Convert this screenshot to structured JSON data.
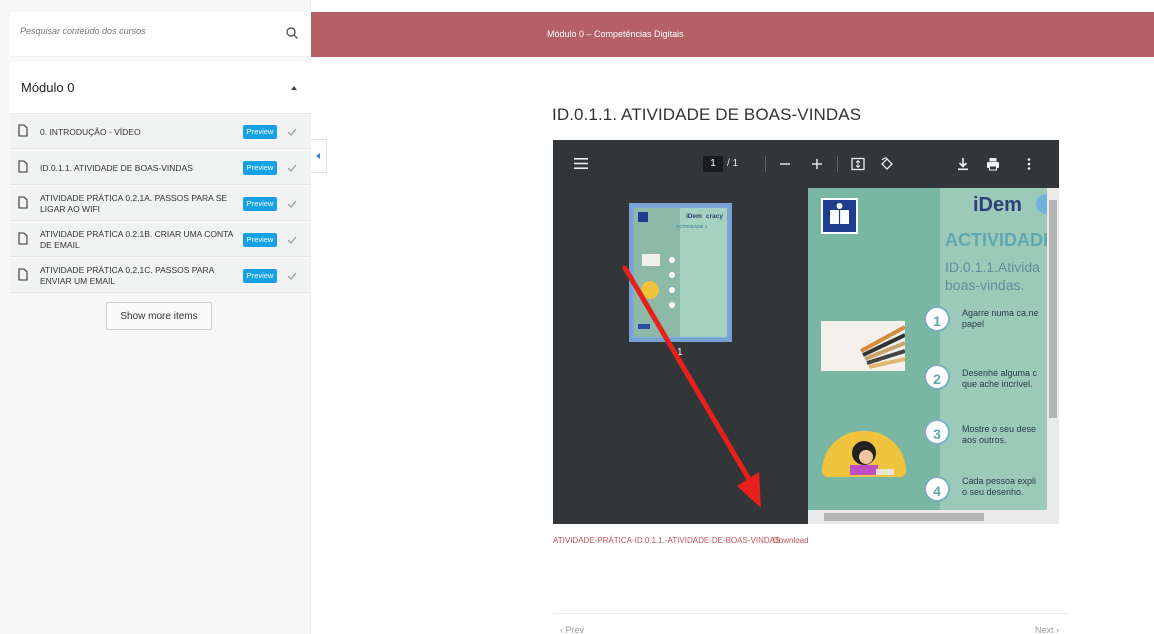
{
  "sidebar": {
    "search_placeholder": "Pesquisar conteúdo dos cursos",
    "section_title": "Módulo 0",
    "lessons": [
      {
        "title": "0. INTRODUÇÃO - VÍDEO",
        "badge": "Preview"
      },
      {
        "title": "ID.0.1.1. ATIVIDADE DE BOAS-VINDAS",
        "badge": "Preview"
      },
      {
        "title": "ATIVIDADE PRÁTICA 0.2.1A. PASSOS PARA SE LIGAR AO WIFI",
        "badge": "Preview"
      },
      {
        "title": "ATIVIDADE PRÁTICA 0.2.1B. CRIAR UMA CONTA DE EMAIL",
        "badge": "Preview"
      },
      {
        "title": "ATIVIDADE PRÁTICA 0.2.1C. PASSOS PARA ENVIAR UM EMAIL",
        "badge": "Preview"
      }
    ],
    "show_more_label": "Show more items"
  },
  "header": {
    "title": "Módulo 0 – Competências Digitais"
  },
  "main": {
    "page_title": "ID.0.1.1. ATIVIDADE DE BOAS-VINDAS",
    "pdf": {
      "current_page": "1",
      "page_total": "/ 1",
      "thumb_page_label": "1",
      "doc_brand": "iDem",
      "doc_heading": "ACTIVIDADE",
      "doc_subtitle_line1": "ID.0.1.1.Ativida",
      "doc_subtitle_line2": "boas-vindas.",
      "steps": [
        {
          "num": "1",
          "line1": "Agarre numa ca.ne",
          "line2": "papel"
        },
        {
          "num": "2",
          "line1": "Desenhe alguma c",
          "line2": "que ache incrível."
        },
        {
          "num": "3",
          "line1": "Mostre o seu dese",
          "line2": "aos outros."
        },
        {
          "num": "4",
          "line1": "Cada pessoa expli",
          "line2": "o seu desenho."
        }
      ]
    },
    "file_name": "ATIVIDADE-PRÁTICA-ID.0.1.1.-ATIVIDADE-DE-BOAS-VINDAS",
    "download_label": "Download",
    "prev_label": "‹ Prev",
    "next_label": "Next ›"
  },
  "colors": {
    "header_bg": "#b46066",
    "badge_bg": "#16a1e6",
    "annotation_arrow": "#e8201c",
    "link": "#c0545b"
  }
}
